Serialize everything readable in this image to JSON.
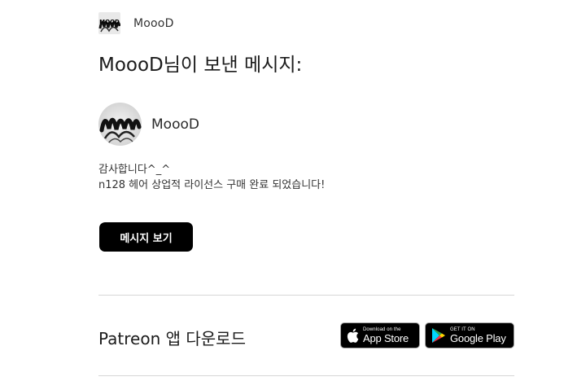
{
  "sender": {
    "logo_text": "MOOD",
    "name": "MoooD"
  },
  "heading": "MoooD님이 보낸 메시지:",
  "author": {
    "name": "MoooD"
  },
  "message": {
    "line1": "감사합니다^_^",
    "line2": "n128 헤어 상업적 라이선스 구매 완료 되었습니다!"
  },
  "button": {
    "label": "메시지 보기"
  },
  "download": {
    "title": "Patreon 앱 다운로드",
    "app_store": {
      "small": "Download on the",
      "big": "App Store",
      "icon": "apple-icon"
    },
    "google_play": {
      "small": "GET IT ON",
      "big": "Google Play",
      "icon": "google-play-icon"
    }
  },
  "colors": {
    "button_bg": "#000000",
    "button_text": "#ffffff",
    "divider": "#d6d6d6"
  }
}
